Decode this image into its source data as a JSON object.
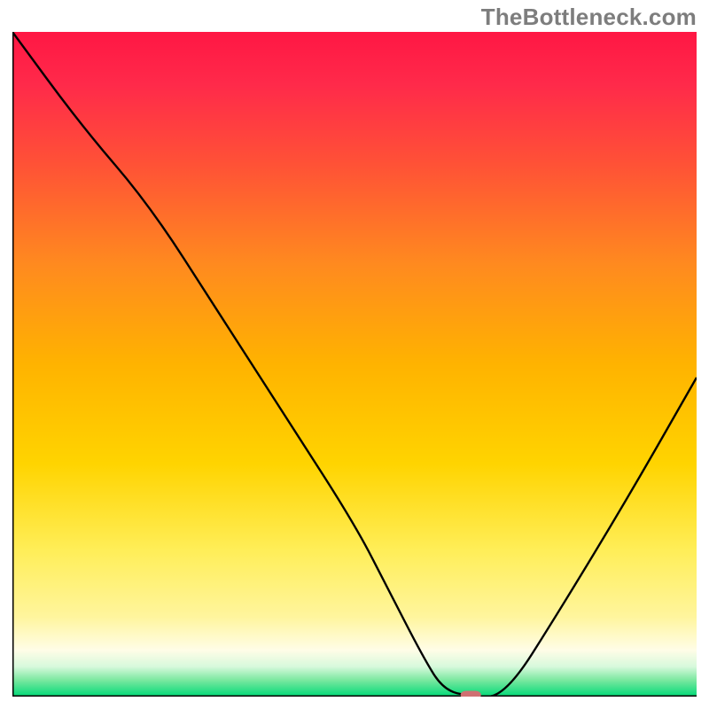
{
  "watermark": "TheBottleneck.com",
  "chart_data": {
    "type": "line",
    "title": "",
    "xlabel": "",
    "ylabel": "",
    "xlim": [
      0,
      100
    ],
    "ylim": [
      0,
      100
    ],
    "grid": false,
    "legend": false,
    "x": [
      0,
      10,
      20,
      30,
      40,
      50,
      55,
      60,
      63,
      67,
      72,
      80,
      90,
      100
    ],
    "values": [
      100,
      86,
      74,
      58,
      42,
      26,
      16,
      6,
      1,
      0,
      0,
      13,
      30,
      48
    ],
    "line_color": "#000000",
    "marker": {
      "x": 67,
      "y": 0,
      "width_pct": 3.0,
      "height_pct": 1.2,
      "color": "#cf7072"
    },
    "background_gradient": [
      {
        "offset": 0.0,
        "color": "#ff1744"
      },
      {
        "offset": 0.08,
        "color": "#ff2a4a"
      },
      {
        "offset": 0.2,
        "color": "#ff5236"
      },
      {
        "offset": 0.35,
        "color": "#ff8a1f"
      },
      {
        "offset": 0.5,
        "color": "#ffb300"
      },
      {
        "offset": 0.65,
        "color": "#ffd400"
      },
      {
        "offset": 0.78,
        "color": "#ffee58"
      },
      {
        "offset": 0.88,
        "color": "#fff59d"
      },
      {
        "offset": 0.93,
        "color": "#fffde7"
      },
      {
        "offset": 0.955,
        "color": "#d7f9dc"
      },
      {
        "offset": 0.975,
        "color": "#7be8a0"
      },
      {
        "offset": 1.0,
        "color": "#00d977"
      }
    ],
    "axis_color": "#000000",
    "axis_width": 3
  }
}
